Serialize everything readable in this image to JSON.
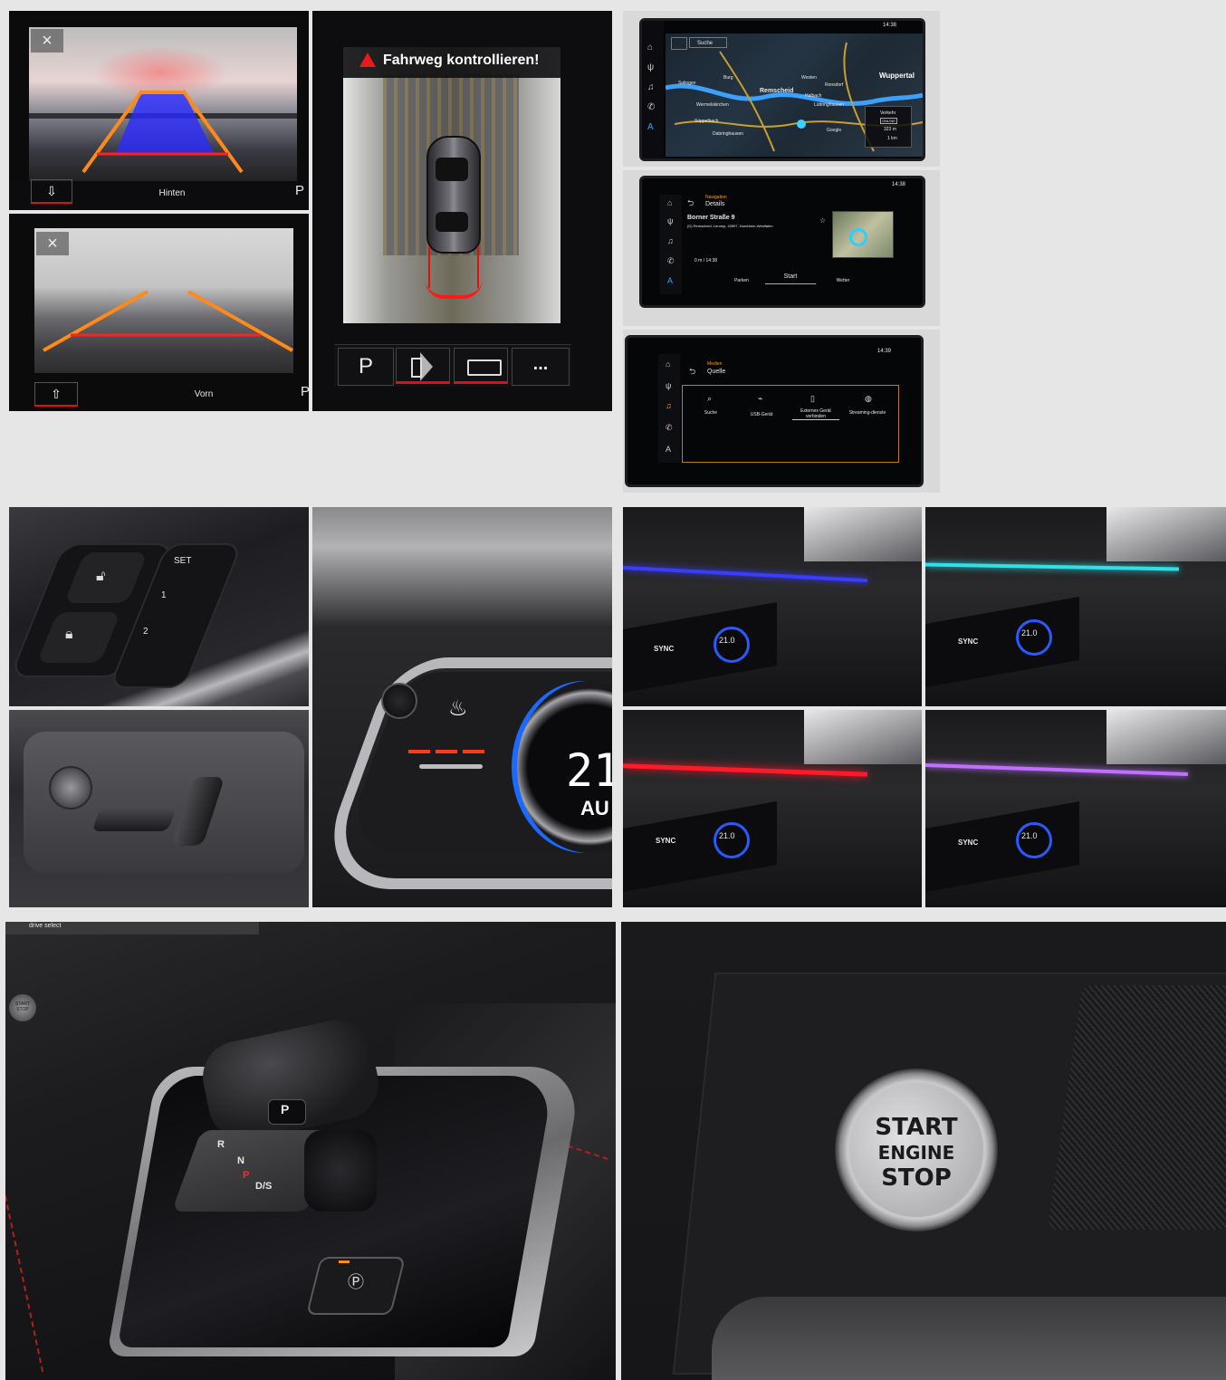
{
  "camera": {
    "rear_label": "Hinten",
    "front_label": "Vorn",
    "park_glyph": "P",
    "warning": "Fahrweg kontrollieren!",
    "buttons": [
      "P",
      "speaker-icon",
      "front-camera-icon",
      "..."
    ]
  },
  "mmi": {
    "time_1": "14:38",
    "time_2": "14:38",
    "time_3": "14:39",
    "map": {
      "search_label": "Suche",
      "places": [
        "Wuppertal",
        "Solingen",
        "Burg",
        "Remscheid",
        "Westen",
        "Ronsdorf",
        "Halbach",
        "Lüttringhausen",
        "Wermelskirchen",
        "Dabringhausen",
        "Süppelbach",
        "Google"
      ],
      "traffic_label": "Verkehr",
      "online_label": "ONLINE",
      "distance": "323 m",
      "scale": "1 km"
    },
    "nav": {
      "header": "Navigation",
      "title": "Details",
      "street": "Borner Straße 9",
      "address": "(D) Remscheid, Lennep, 42897, Nordrhein-Westfalen",
      "distance_time": "0 m / 14:38",
      "actions": [
        "Parken",
        "Start",
        "Wetter"
      ]
    },
    "media": {
      "header": "Medien",
      "title": "Quelle",
      "sources": [
        "Suche",
        "USB-Gerät",
        "Externes Gerät verbinden",
        "Streaming-dienste"
      ]
    }
  },
  "seat": {
    "memory_set": "SET",
    "memory_1": "1",
    "memory_2": "2"
  },
  "climate": {
    "temp": "21",
    "temp_display": "21.0",
    "auto": "AU",
    "sync": "SYNC",
    "ambient_colors": [
      "#3a3cff",
      "#2ee0e8",
      "#ff1a2a",
      "#c070ff"
    ]
  },
  "console": {
    "gears": [
      "P",
      "R",
      "N",
      "D/S"
    ],
    "drive_select": "drive select",
    "start_stop_small": "START STOP"
  },
  "start_button": {
    "line1": "START",
    "line2": "ENGINE",
    "line3": "STOP"
  }
}
